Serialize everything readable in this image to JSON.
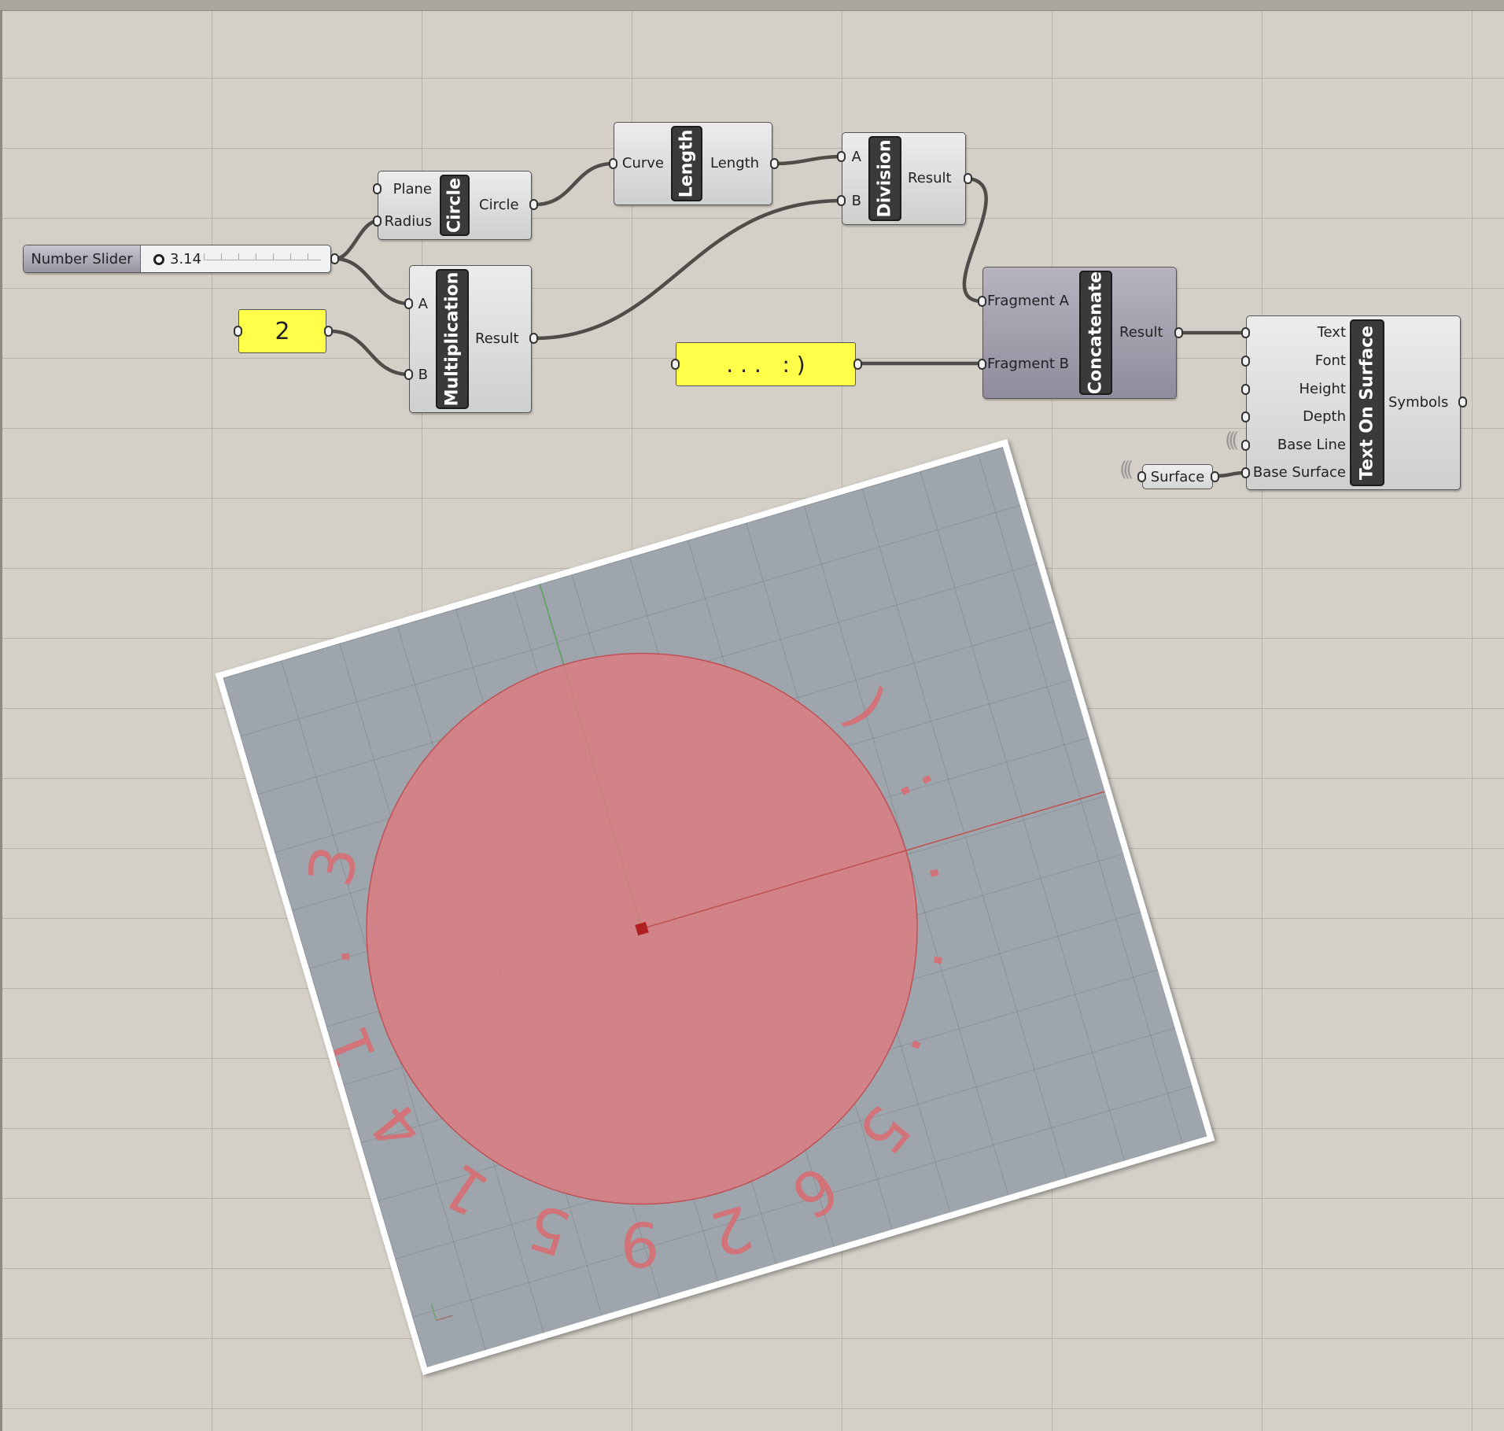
{
  "slider": {
    "label": "Number Slider",
    "value": "3.14"
  },
  "panel_two": {
    "text": "2"
  },
  "panel_smile": {
    "text": ". . .   : )"
  },
  "circle": {
    "name": "Circle",
    "inputs": [
      "Plane",
      "Radius"
    ],
    "output": "Circle"
  },
  "length": {
    "name": "Length",
    "input": "Curve",
    "output": "Length"
  },
  "division": {
    "name": "Division",
    "inputs": [
      "A",
      "B"
    ],
    "output": "Result"
  },
  "multiplication": {
    "name": "Multiplication",
    "inputs": [
      "A",
      "B"
    ],
    "output": "Result"
  },
  "concatenate": {
    "name": "Concatenate",
    "inputs": [
      "Fragment A",
      "Fragment B"
    ],
    "output": "Result"
  },
  "text_on_surface": {
    "name": "Text On Surface",
    "inputs": [
      "Text",
      "Font",
      "Height",
      "Depth",
      "Base Line",
      "Base Surface"
    ],
    "output": "Symbols"
  },
  "surface_param": {
    "label": "Surface"
  },
  "viewport": {
    "curved_text_characters": [
      "3",
      ".",
      "1",
      "4",
      "1",
      "5",
      "9",
      "2",
      "6",
      "5",
      ".",
      ".",
      ".",
      ":",
      ")"
    ],
    "colors": {
      "background": "#9ea5ad",
      "disc_fill": "#d97c80",
      "text": "#d96a6e",
      "x_axis": "#c0504d",
      "y_axis": "#5aa05a"
    }
  },
  "colors": {
    "canvas": "#d4d0c8",
    "panel_yellow": "#ffff4a",
    "wire": "#4f4d49"
  }
}
